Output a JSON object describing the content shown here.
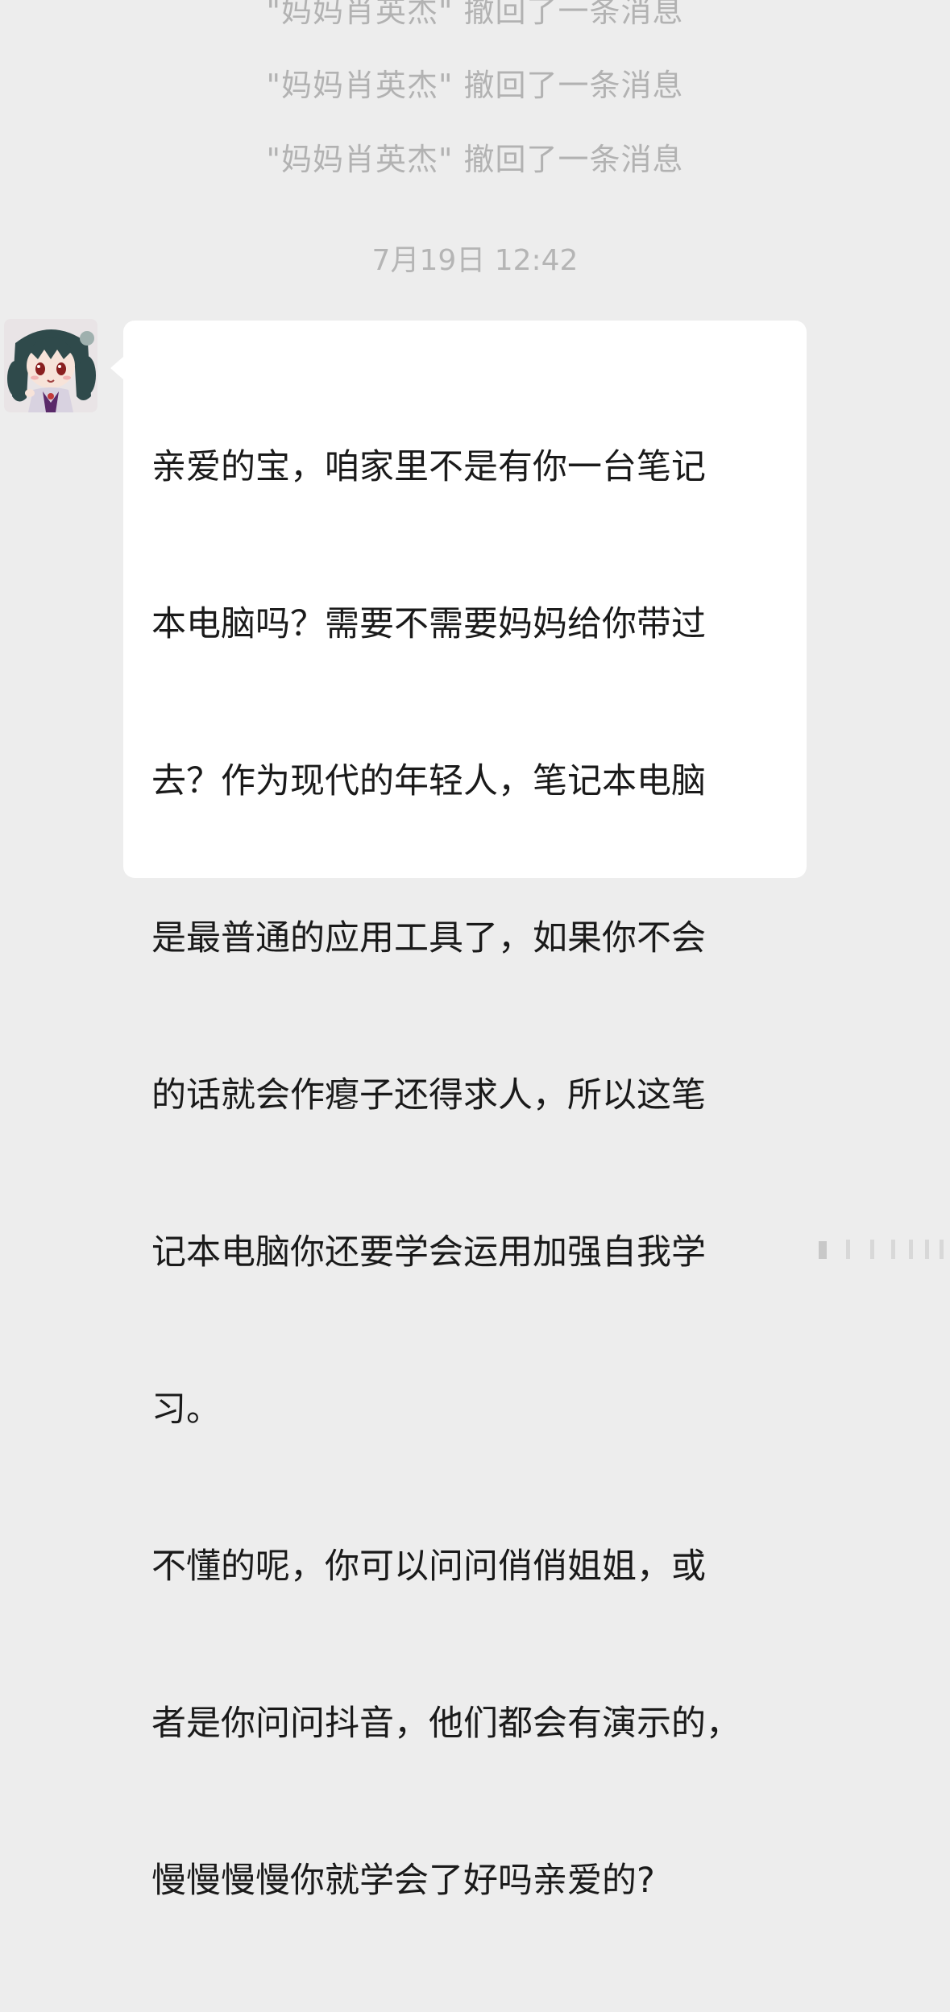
{
  "recalled_messages": [
    "\"妈妈肖英杰\" 撤回了一条消息",
    "\"妈妈肖英杰\" 撤回了一条消息",
    "\"妈妈肖英杰\" 撤回了一条消息"
  ],
  "timestamp": "7月19日 12:42",
  "message": {
    "lines": [
      "亲爱的宝，咱家里不是有你一台笔记",
      "本电脑吗？需要不需要妈妈给你带过",
      "去？作为现代的年轻人，笔记本电脑",
      "是最普通的应用工具了，如果你不会",
      "的话就会作瘪子还得求人，所以这笔",
      "记本电脑你还要学会运用加强自我学",
      "习。",
      "不懂的呢，你可以问问俏俏姐姐，或",
      "者是你问问抖音，他们都会有演示的，",
      "慢慢慢慢你就学会了好吗亲爱的?"
    ]
  },
  "avatar": {
    "icon": "anime-girl-avatar"
  },
  "colors": {
    "background": "#ededed",
    "bubble": "#ffffff",
    "system_text": "#b2b2b2",
    "message_text": "#1a1a1a"
  }
}
